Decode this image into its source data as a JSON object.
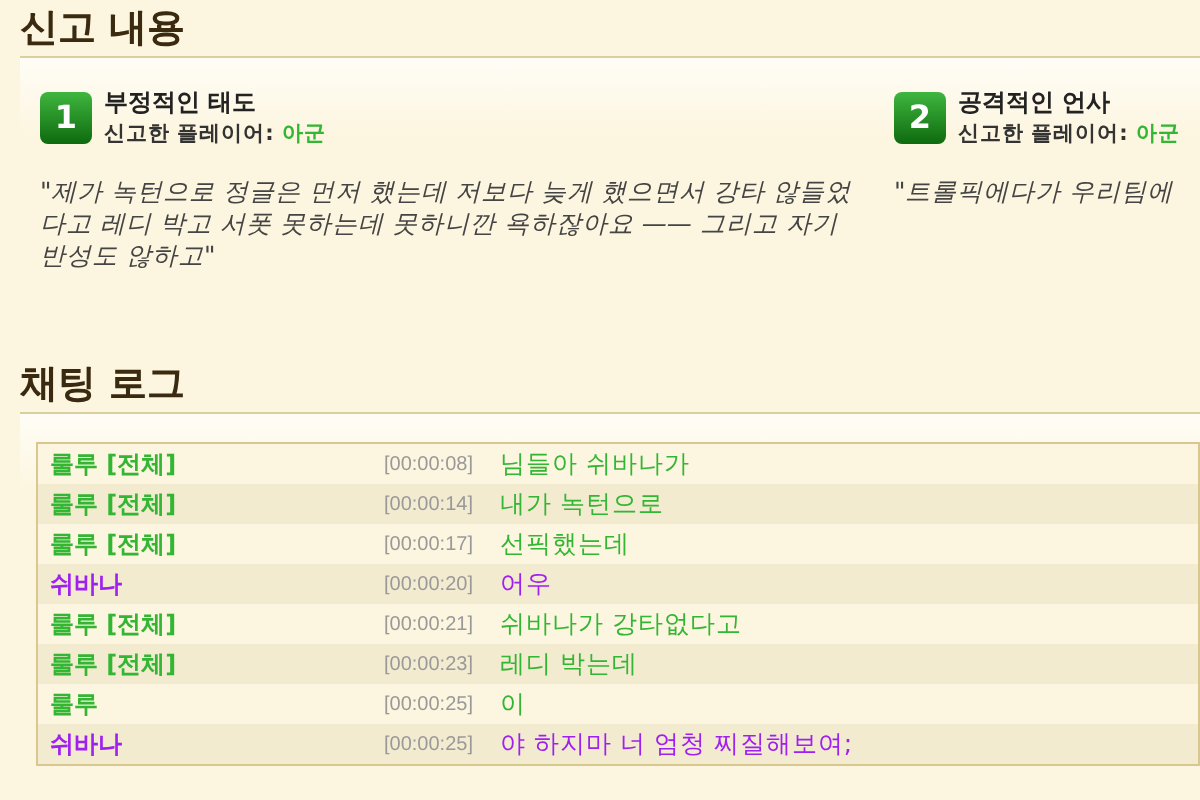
{
  "report_section": {
    "title": "신고 내용",
    "reports": [
      {
        "number": "1",
        "reason": "부정적인 태도",
        "reporter_label": "신고한 플레이어:",
        "reporter": "아군",
        "quote": "\"제가 녹턴으로 정글은 먼저 했는데 저보다 늦게 했으면서 강타 않들었다고 레디 박고 서폿 못하는데 못하니깐 욕하잖아요 —— 그리고 자기 반성도 않하고\""
      },
      {
        "number": "2",
        "reason": "공격적인 언사",
        "reporter_label": "신고한 플레이어:",
        "reporter": "아군",
        "quote": "\"트롤픽에다가 우리팀에"
      }
    ]
  },
  "chat_section": {
    "title": "채팅 로그",
    "messages": [
      {
        "player": "룰루 [전체]",
        "time": "[00:00:08]",
        "text": "님들아 쉬바나가",
        "color": "#33b633"
      },
      {
        "player": "룰루 [전체]",
        "time": "[00:00:14]",
        "text": "내가 녹턴으로",
        "color": "#33b633"
      },
      {
        "player": "룰루 [전체]",
        "time": "[00:00:17]",
        "text": "선픽했는데",
        "color": "#33b633"
      },
      {
        "player": "쉬바나",
        "time": "[00:00:20]",
        "text": "어우",
        "color": "#a020f0"
      },
      {
        "player": "룰루 [전체]",
        "time": "[00:00:21]",
        "text": "쉬바나가 강타없다고",
        "color": "#33b633"
      },
      {
        "player": "룰루 [전체]",
        "time": "[00:00:23]",
        "text": "레디 박는데",
        "color": "#33b633"
      },
      {
        "player": "룰루",
        "time": "[00:00:25]",
        "text": "이",
        "color": "#33b633"
      },
      {
        "player": "쉬바나",
        "time": "[00:00:25]",
        "text": "야 하지마 너 엄청 찌질해보여;",
        "color": "#a020f0"
      }
    ]
  }
}
